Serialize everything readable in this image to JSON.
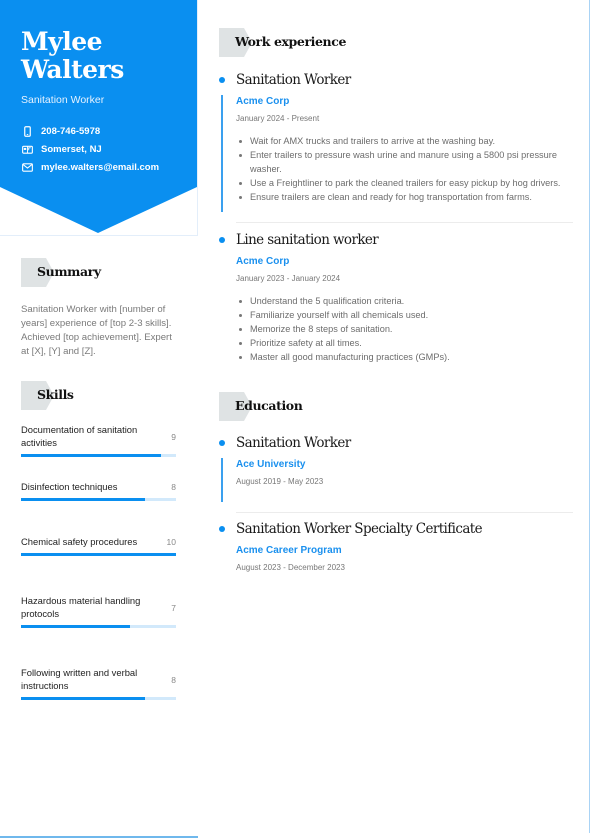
{
  "profile": {
    "name_first": "Mylee",
    "name_last": "Walters",
    "role": "Sanitation Worker",
    "contacts": [
      {
        "icon": "phone-icon",
        "text": "208-746-5978"
      },
      {
        "icon": "location-icon",
        "text": "Somerset, NJ"
      },
      {
        "icon": "email-icon",
        "text": "mylee.walters@email.com"
      }
    ]
  },
  "sections": {
    "summary": "Summary",
    "skills": "Skills",
    "work": "Work experience",
    "education": "Education"
  },
  "summary_text": "Sanitation Worker with [number of years] experience of [top 2-3 skills]. Achieved [top achievement]. Expert at [X], [Y] and [Z].",
  "skills": [
    {
      "name": "Documentation of sanitation activities",
      "level": 9,
      "max": 10
    },
    {
      "name": "Disinfection techniques",
      "level": 8,
      "max": 10
    },
    {
      "name": "Chemical safety procedures",
      "level": 10,
      "max": 10
    },
    {
      "name": "Hazardous material handling protocols",
      "level": 7,
      "max": 10
    },
    {
      "name": "Following written and verbal instructions",
      "level": 8,
      "max": 10
    }
  ],
  "work": [
    {
      "title": "Sanitation Worker",
      "org": "Acme Corp",
      "dates": "January 2024 - Present",
      "bullets": [
        "Wait for AMX trucks and trailers to arrive at the washing bay.",
        "Enter trailers to pressure wash urine and manure using a 5800 psi pressure washer.",
        "Use a Freightliner to park the cleaned trailers for easy pickup by hog drivers.",
        "Ensure trailers are clean and ready for hog transportation from farms."
      ]
    },
    {
      "title": "Line sanitation worker",
      "org": "Acme Corp",
      "dates": "January 2023 - January 2024",
      "bullets": [
        "Understand the 5 qualification criteria.",
        "Familiarize yourself with all chemicals used.",
        "Memorize the 8 steps of sanitation.",
        "Prioritize safety at all times.",
        "Master all good manufacturing practices (GMPs)."
      ]
    }
  ],
  "education": [
    {
      "title": "Sanitation Worker",
      "org": "Ace University",
      "dates": "August 2019 - May 2023"
    },
    {
      "title": "Sanitation Worker Specialty Certificate",
      "org": "Acme Career Program",
      "dates": "August 2023 - December 2023"
    }
  ],
  "colors": {
    "accent": "#0a8ff0",
    "header_bg": "#0a8ff0",
    "tag_bg": "#dfe3e4",
    "skill_track": "#d2e9fb"
  }
}
